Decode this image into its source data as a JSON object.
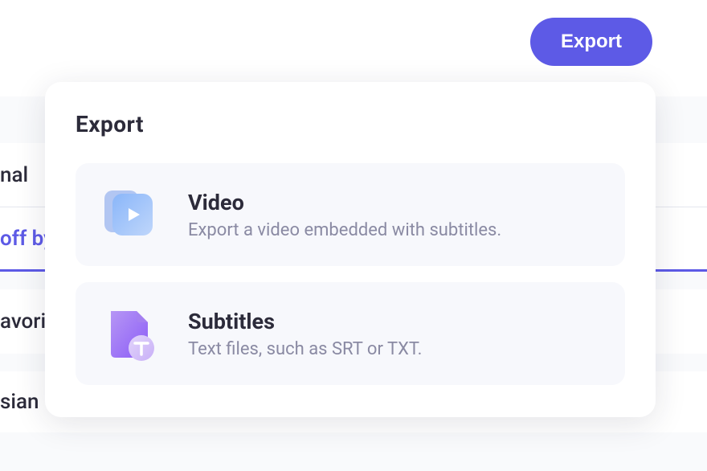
{
  "header": {
    "export_button": "Export"
  },
  "background": {
    "rows": [
      {
        "label": "nal"
      },
      {
        "label": "off by"
      },
      {
        "label": "avorit"
      },
      {
        "label": "sian "
      }
    ]
  },
  "modal": {
    "title": "Export",
    "options": [
      {
        "icon": "video-icon",
        "title": "Video",
        "description": "Export a video embedded with subtitles."
      },
      {
        "icon": "subtitles-icon",
        "title": "Subtitles",
        "description": "Text files, such as SRT or TXT."
      }
    ]
  }
}
